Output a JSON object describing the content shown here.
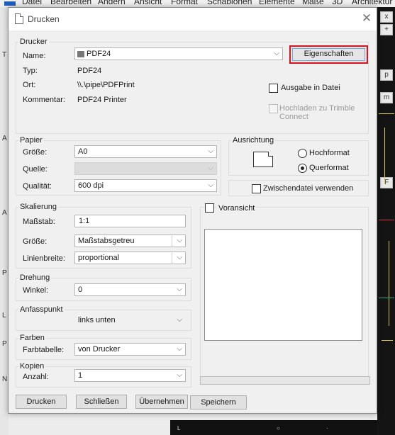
{
  "app": {
    "menu": [
      "Datei",
      "Bearbeiten",
      "Ändern",
      "Ansicht",
      "Format",
      "Schablonen",
      "Elemente",
      "Maße",
      "3D",
      "Architektur"
    ],
    "left_labels": [
      "T",
      "A",
      "A",
      "P",
      "L",
      "P",
      "N"
    ],
    "right_icons": [
      "x",
      "+",
      "p",
      "m",
      "F"
    ]
  },
  "dialog": {
    "title": "Drucken",
    "close_glyph": "✕",
    "drucker": {
      "legend": "Drucker",
      "name_label": "Name:",
      "name_value": "PDF24",
      "typ_label": "Typ:",
      "typ_value": "PDF24",
      "ort_label": "Ort:",
      "ort_value": "\\\\.\\pipe\\PDFPrint",
      "kommentar_label": "Kommentar:",
      "kommentar_value": "PDF24 Printer",
      "eigenschaften_button": "Eigenschaften",
      "ausgabe_in_datei": "Ausgabe in Datei",
      "hochladen_line1": "Hochladen zu Trimble",
      "hochladen_line2": "Connect"
    },
    "papier": {
      "legend": "Papier",
      "groesse_label": "Größe:",
      "groesse_value": "A0",
      "quelle_label": "Quelle:",
      "quelle_value": "",
      "qualitaet_label": "Qualität:",
      "qualitaet_value": "600 dpi"
    },
    "ausrichtung": {
      "legend": "Ausrichtung",
      "hochformat": "Hochformat",
      "querformat": "Querformat",
      "selected": "Querformat",
      "zwischendatei": "Zwischendatei verwenden"
    },
    "skalierung": {
      "legend": "Skalierung",
      "massstab_label": "Maßstab:",
      "massstab_value": "1:1",
      "groesse_label": "Größe:",
      "groesse_value": "Maßstabsgetreu",
      "linienbreite_label": "Linienbreite:",
      "linienbreite_value": "proportional"
    },
    "voransicht": {
      "label": "Voransicht"
    },
    "drehung": {
      "legend": "Drehung",
      "winkel_label": "Winkel:",
      "winkel_value": "0"
    },
    "anfasspunkt": {
      "legend": "Anfasspunkt",
      "value": "links unten"
    },
    "farben": {
      "legend": "Farben",
      "farbtabelle_label": "Farbtabelle:",
      "farbtabelle_value": "von Drucker"
    },
    "kopien": {
      "legend": "Kopien",
      "anzahl_label": "Anzahl:",
      "anzahl_value": "1"
    },
    "buttons": {
      "drucken": "Drucken",
      "schliessen": "Schließen",
      "uebernehmen": "Übernehmen",
      "speichern": "Speichern"
    }
  }
}
